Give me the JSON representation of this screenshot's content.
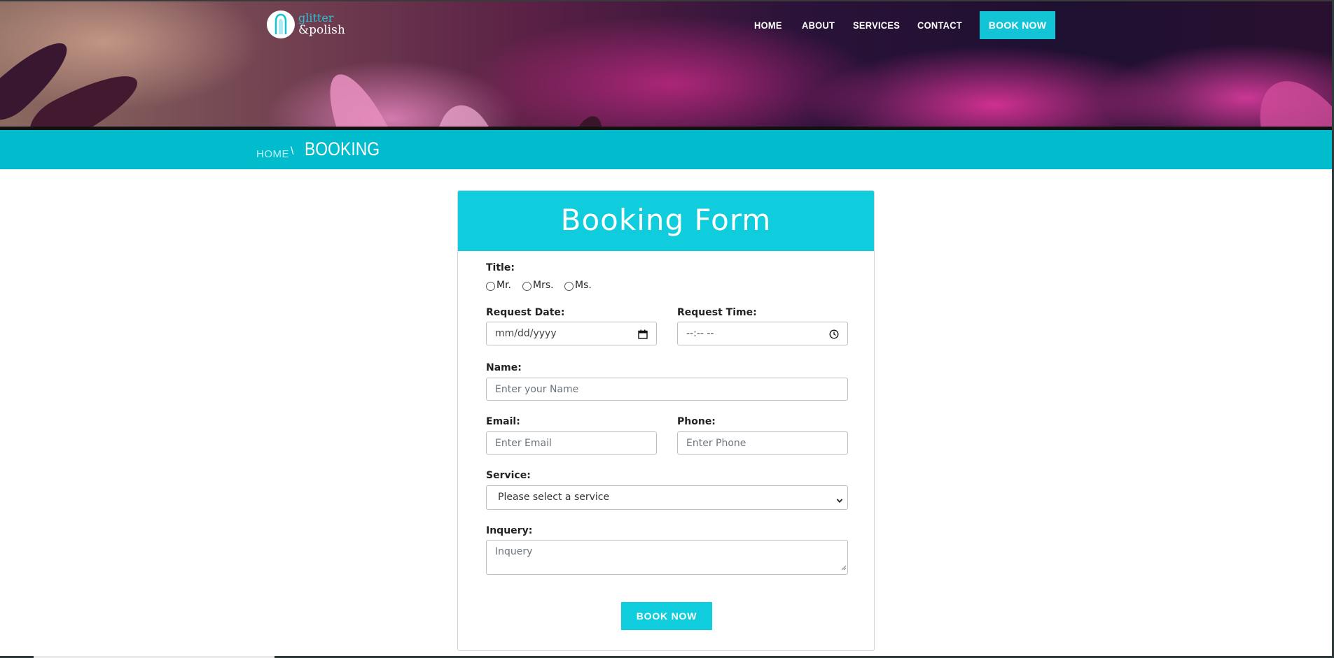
{
  "brand": {
    "logo_line1": "glitter",
    "logo_line2": "&polish",
    "accent_color": "#13c3d6"
  },
  "nav": {
    "items": [
      "HOME",
      "ABOUT",
      "SERVICES",
      "CONTACT"
    ],
    "cta": "BOOK NOW"
  },
  "breadcrumb": {
    "home": "HOME",
    "separator": "\\",
    "current": "BOOKING"
  },
  "form": {
    "title": "Booking Form",
    "title_label": "Title:",
    "title_options": [
      "Mr.",
      "Mrs.",
      "Ms."
    ],
    "request_date_label": "Request Date:",
    "request_date_placeholder": "mm/dd/yyyy",
    "request_time_label": "Request Time:",
    "request_time_placeholder": "--:-- --",
    "name_label": "Name:",
    "name_placeholder": "Enter your Name",
    "email_label": "Email:",
    "email_placeholder": "Enter Email",
    "phone_label": "Phone:",
    "phone_placeholder": "Enter Phone",
    "service_label": "Service:",
    "service_selected": "Please select a service",
    "inquiry_label": "Inquery:",
    "inquiry_placeholder": "Inquery",
    "submit": "BOOK NOW"
  },
  "icons": {
    "calendar": "calendar-icon",
    "clock": "clock-icon",
    "dropdown": "chevron-down-icon",
    "resize": "resize-grip-icon"
  }
}
